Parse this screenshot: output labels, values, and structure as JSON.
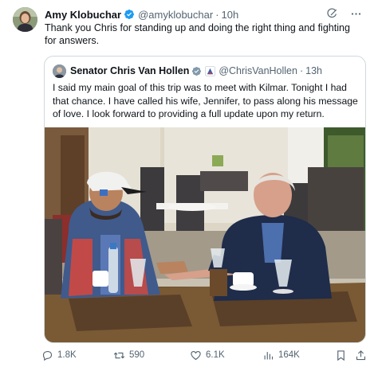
{
  "author": {
    "name": "Amy Klobuchar",
    "handle": "@amyklobuchar",
    "time": "10h",
    "separator": "·"
  },
  "tweet_text": "Thank you Chris for standing up and doing the right thing and fighting for answers.",
  "quote": {
    "name": "Senator Chris Van Hollen",
    "handle": "@ChrisVanHollen",
    "time": "13h",
    "separator": "·",
    "text": "I said my main goal of this trip was to meet with Kilmar. Tonight I had that chance. I have called his wife, Jennifer, to pass along his message of love. I look forward to providing a full update upon my return."
  },
  "actions": {
    "replies": "1.8K",
    "retweets": "590",
    "likes": "6.1K",
    "views": "164K"
  },
  "icons": {
    "verified": "verified-badge-icon",
    "gov": "gov-badge-icon",
    "grok": "grok-icon",
    "more": "more-icon",
    "reply": "reply-icon",
    "retweet": "retweet-icon",
    "like": "heart-icon",
    "views": "views-icon",
    "bookmark": "bookmark-icon",
    "share": "share-icon"
  },
  "colors": {
    "verified_blue": "#1d9bf0",
    "gov_gray": "#829aab",
    "text_primary": "#0f1419",
    "text_secondary": "#536471",
    "border": "#cfd9de"
  }
}
